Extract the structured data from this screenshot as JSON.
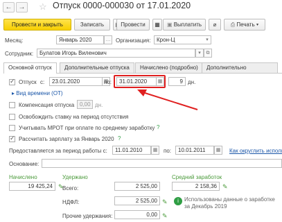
{
  "title": "Отпуск 0000-000030 от 17.01.2020",
  "toolbar": {
    "post_close": "Провести и закрыть",
    "save": "Записать",
    "post": "Провести",
    "pay": "Выплатить",
    "print": "Печать"
  },
  "header": {
    "month_label": "Месяц:",
    "month_value": "Январь 2020",
    "org_label": "Организация:",
    "org_value": "Крон-Ц",
    "employee_label": "Сотрудник:",
    "employee_value": "Булатов Игорь Виленович"
  },
  "tabs": [
    "Основной отпуск",
    "Дополнительные отпуска",
    "Начислено (подробно)",
    "Дополнительно"
  ],
  "vacation": {
    "label": "Отпуск",
    "from_label": "с:",
    "from_value": "23.01.2020",
    "to_label": "по:",
    "to_value": "31.01.2020",
    "days_value": "9",
    "days_unit": "дн.",
    "time_type_link": "Вид времени (ОТ)"
  },
  "compensation": {
    "label": "Компенсация отпуска",
    "days_value": "0,00",
    "days_unit": "дн."
  },
  "options": {
    "free_rate": "Освобождить ставку на период отсутствия",
    "mrot": "Учитывать МРОТ при оплате по среднему заработку",
    "calc_salary": "Рассчитать зарплату за Январь 2020"
  },
  "period": {
    "label": "Предоставляется за период работы с:",
    "from_value": "11.01.2010",
    "to_label": "по:",
    "to_value": "10.01.2011",
    "link": "Как округлить исполь"
  },
  "basis_label": "Основание:",
  "accrued": {
    "label": "Начислено",
    "value": "19 425,24"
  },
  "withheld": {
    "label": "Удержано",
    "total_label": "Всего:",
    "total_value": "2 525,00",
    "ndfl_label": "НДФЛ:",
    "ndfl_value": "2 525,00",
    "other_label": "Прочие удержания:",
    "other_value": "0,00"
  },
  "avg": {
    "label": "Средний заработок",
    "value": "2 158,36",
    "info": "Использованы данные о заработке за Декабрь 2019"
  },
  "colors": {
    "primary_button": "#f7cf00",
    "highlight": "#e02020",
    "link": "#1a56a8",
    "accent_green": "#4a9a3a"
  }
}
